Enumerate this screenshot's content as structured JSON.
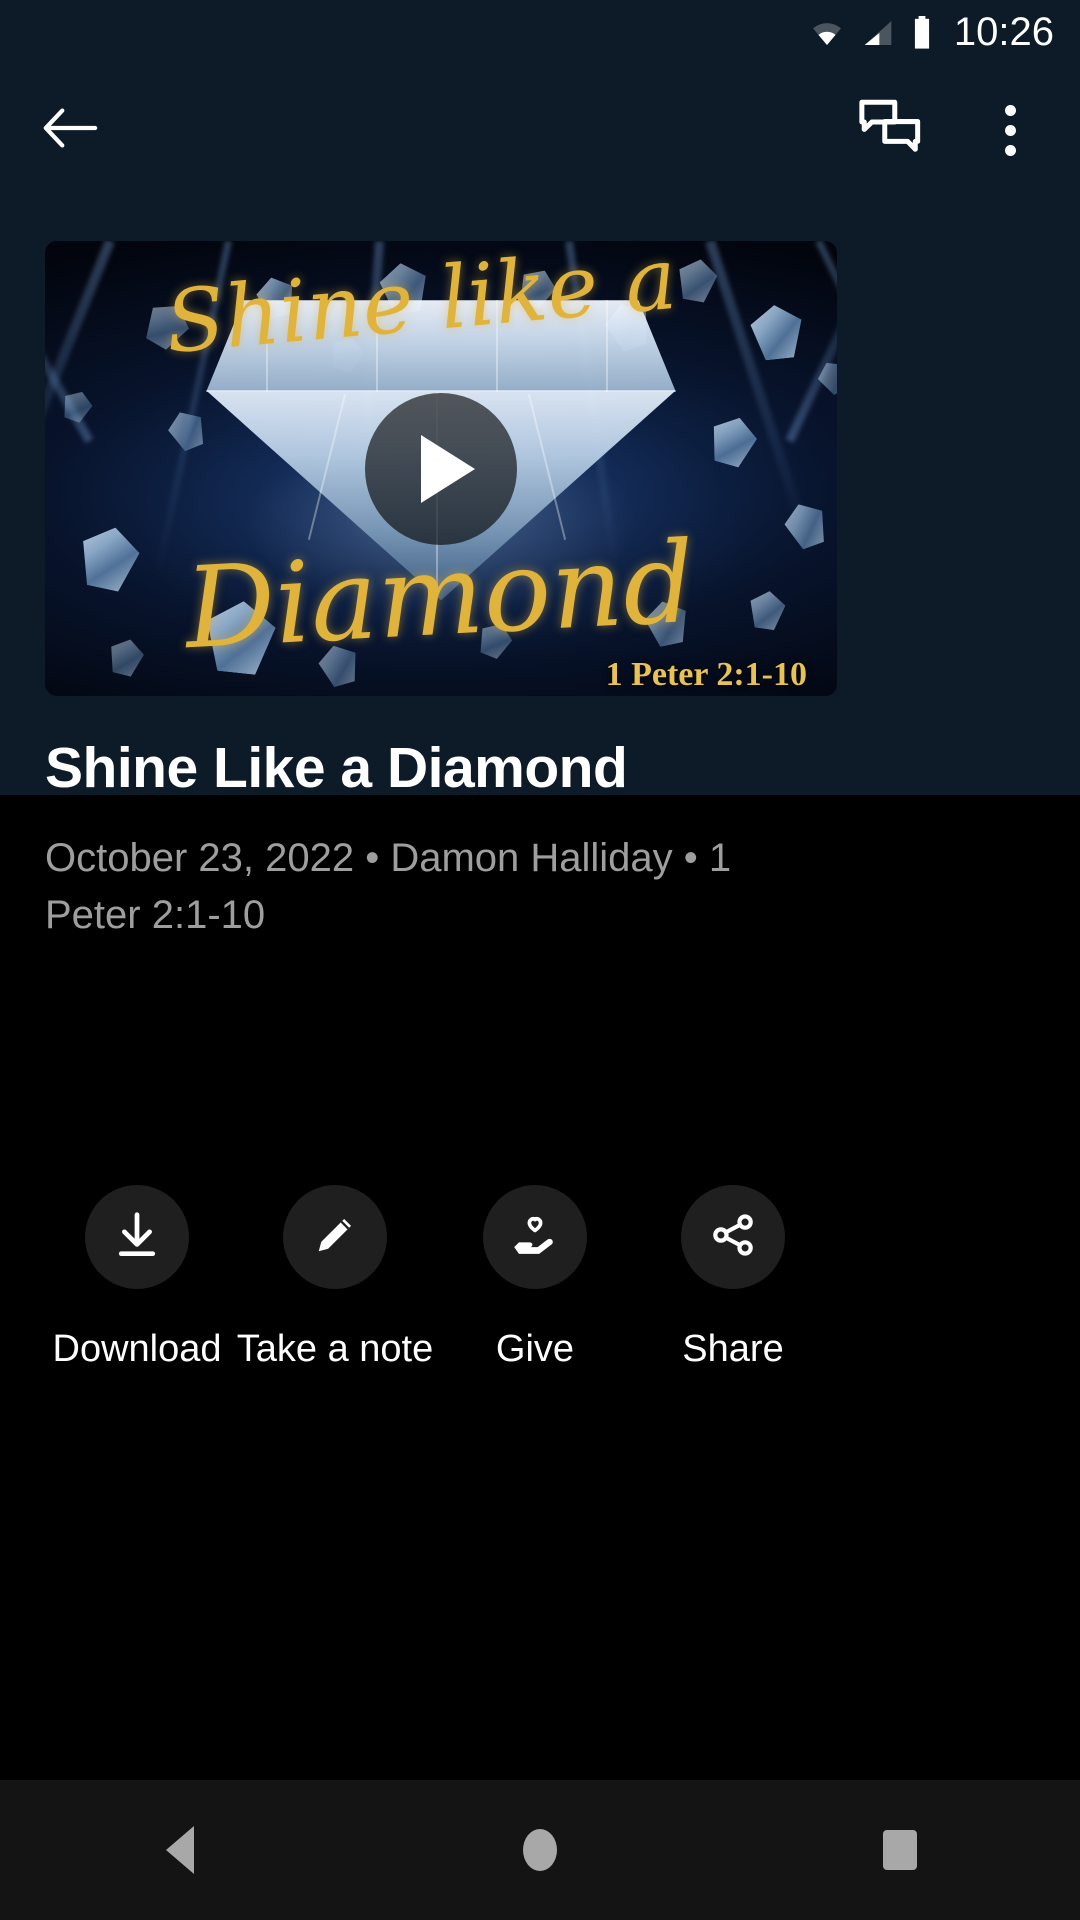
{
  "status_bar": {
    "time": "10:26",
    "icons": [
      "wifi-icon",
      "cellular-signal-icon",
      "battery-icon"
    ]
  },
  "toolbar": {
    "back_icon": "arrow-back-icon",
    "chat_icon": "chat-bubbles-icon",
    "overflow_icon": "more-vertical-icon"
  },
  "media": {
    "play_icon": "play-triangle-icon",
    "artwork": {
      "script_top": "Shine like a",
      "script_bottom": "Diamond",
      "reference": "1 Peter 2:1-10"
    }
  },
  "sermon": {
    "title": "Shine Like a Diamond",
    "meta": "October 23, 2022 • Damon Halliday • 1 Peter 2:1-10",
    "date": "October 23, 2022",
    "speaker": "Damon Halliday",
    "scripture": "1 Peter 2:1-10"
  },
  "actions": [
    {
      "label": "Download",
      "icon": "download-icon"
    },
    {
      "label": "Take a note",
      "icon": "pencil-icon"
    },
    {
      "label": "Give",
      "icon": "hand-heart-icon"
    },
    {
      "label": "Share",
      "icon": "share-nodes-icon"
    }
  ],
  "navbar": {
    "back": "nav-back-icon",
    "home": "nav-home-icon",
    "recents": "nav-recents-icon"
  },
  "colors": {
    "header_background": "#0d1a27",
    "page_background": "#000000",
    "accent_gold": "#e0b33c",
    "meta_text": "#9e9e9e",
    "action_circle": "#1f1f1f",
    "navbar": "#141414"
  }
}
